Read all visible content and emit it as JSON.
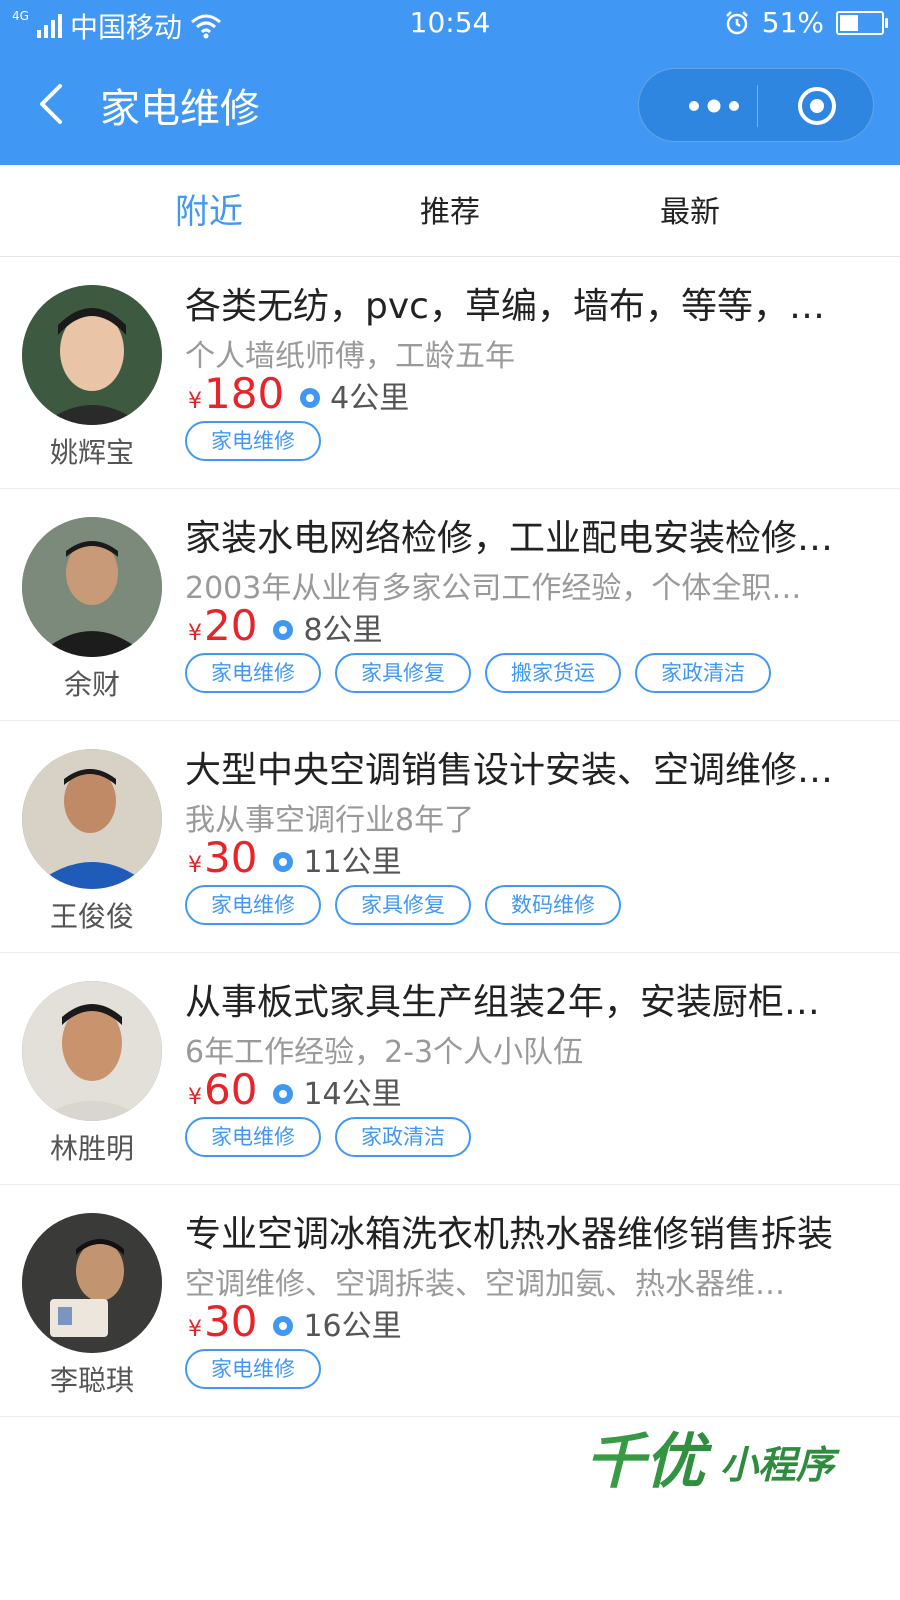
{
  "status_bar": {
    "network": "4G",
    "carrier": "中国移动",
    "time": "10:54",
    "battery_text": "51%",
    "battery_level": 0.51
  },
  "nav": {
    "title": "家电维修",
    "icons": {
      "back": "back-chevron-icon",
      "more": "more-dots-icon",
      "close": "target-circle-icon"
    }
  },
  "tabs": [
    {
      "label": "附近",
      "active": true
    },
    {
      "label": "推荐",
      "active": false
    },
    {
      "label": "最新",
      "active": false
    }
  ],
  "list": [
    {
      "name": "姚辉宝",
      "title": "各类无纺，pvc，草编，墙布，等等，…",
      "desc": "个人墙纸师傅，工龄五年",
      "currency": "¥",
      "price": "180",
      "distance": "4公里",
      "tags": [
        "家电维修"
      ]
    },
    {
      "name": "余财",
      "title": "家装水电网络检修，工业配电安装检修…",
      "desc": "2003年从业有多家公司工作经验，个体全职…",
      "currency": "¥",
      "price": "20",
      "distance": "8公里",
      "tags": [
        "家电维修",
        "家具修复",
        "搬家货运",
        "家政清洁"
      ]
    },
    {
      "name": "王俊俊",
      "title": "大型中央空调销售设计安装、空调维修…",
      "desc": "我从事空调行业8年了",
      "currency": "¥",
      "price": "30",
      "distance": "11公里",
      "tags": [
        "家电维修",
        "家具修复",
        "数码维修"
      ]
    },
    {
      "name": "林胜明",
      "title": "从事板式家具生产组装2年，安装厨柜…",
      "desc": "6年工作经验，2-3个人小队伍",
      "currency": "¥",
      "price": "60",
      "distance": "14公里",
      "tags": [
        "家电维修",
        "家政清洁"
      ]
    },
    {
      "name": "李聪琪",
      "title": "专业空调冰箱洗衣机热水器维修销售拆装",
      "desc": "空调维修、空调拆装、空调加氨、热水器维…",
      "currency": "¥",
      "price": "30",
      "distance": "16公里",
      "tags": [
        "家电维修"
      ]
    }
  ],
  "watermark": {
    "text": "千优小程序"
  },
  "colors": {
    "brand_blue": "#4198f4",
    "price_red": "#e8242a"
  }
}
